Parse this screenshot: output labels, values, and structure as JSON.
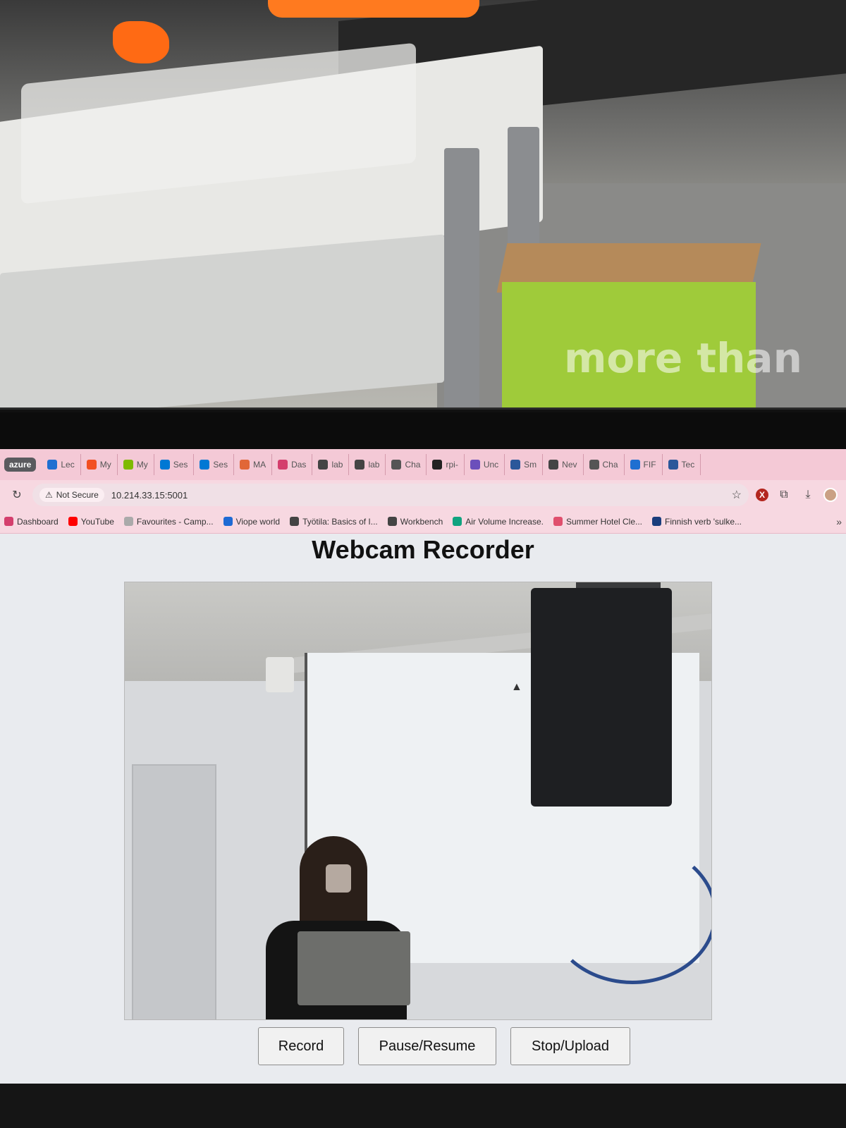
{
  "surroundings": {
    "box_text": "more than"
  },
  "browser": {
    "tab_group": "azure",
    "tabs": [
      {
        "label": "Lec",
        "icon": "onedrive-icon",
        "color": "#1f6fd1"
      },
      {
        "label": "My",
        "icon": "microsoft-icon",
        "color": "#f25022"
      },
      {
        "label": "My",
        "icon": "microsoft-icon",
        "color": "#7fba00"
      },
      {
        "label": "Ses",
        "icon": "azure-icon",
        "color": "#0078d4"
      },
      {
        "label": "Ses",
        "icon": "azure-icon",
        "color": "#0078d4"
      },
      {
        "label": "MA",
        "icon": "matlab-icon",
        "color": "#e16737"
      },
      {
        "label": "Das",
        "icon": "s-icon",
        "color": "#d43f6d"
      },
      {
        "label": "lab",
        "icon": "globe-icon",
        "color": "#444444"
      },
      {
        "label": "lab",
        "icon": "globe-icon",
        "color": "#444444"
      },
      {
        "label": "Cha",
        "icon": "chatgpt-icon",
        "color": "#555555"
      },
      {
        "label": "rpi-",
        "icon": "github-icon",
        "color": "#222222"
      },
      {
        "label": "Unc",
        "icon": "purple-icon",
        "color": "#6b4fbb"
      },
      {
        "label": "Sm",
        "icon": "word-icon",
        "color": "#2b579a"
      },
      {
        "label": "Nev",
        "icon": "globe-icon",
        "color": "#444444"
      },
      {
        "label": "Cha",
        "icon": "chatgpt-icon",
        "color": "#555555"
      },
      {
        "label": "FIF",
        "icon": "onedrive-icon",
        "color": "#1f6fd1"
      },
      {
        "label": "Tec",
        "icon": "word-icon",
        "color": "#2b579a"
      }
    ],
    "security_label": "Not Secure",
    "url": "10.214.33.15:5001",
    "bookmarks": [
      {
        "label": "Dashboard",
        "icon": "s-icon",
        "color": "#d43f6d"
      },
      {
        "label": "YouTube",
        "icon": "youtube-icon",
        "color": "#ff0000"
      },
      {
        "label": "Favourites - Camp...",
        "icon": "cloud-icon",
        "color": "#aaaaaa"
      },
      {
        "label": "Viope world",
        "icon": "check-icon",
        "color": "#1e6ad4"
      },
      {
        "label": "Työtila: Basics of I...",
        "icon": "globe-icon",
        "color": "#444444"
      },
      {
        "label": "Workbench",
        "icon": "globe-icon",
        "color": "#444444"
      },
      {
        "label": "Air Volume Increase.",
        "icon": "chatgpt-icon",
        "color": "#10a37f"
      },
      {
        "label": "Summer Hotel Cle...",
        "icon": "heart-icon",
        "color": "#e04f6d"
      },
      {
        "label": "Finnish verb 'sulke...",
        "icon": "bookmark-icon",
        "color": "#1a3d7c"
      }
    ]
  },
  "page": {
    "title": "Webcam Recorder",
    "buttons": {
      "record": "Record",
      "pause": "Pause/Resume",
      "stop": "Stop/Upload"
    }
  }
}
